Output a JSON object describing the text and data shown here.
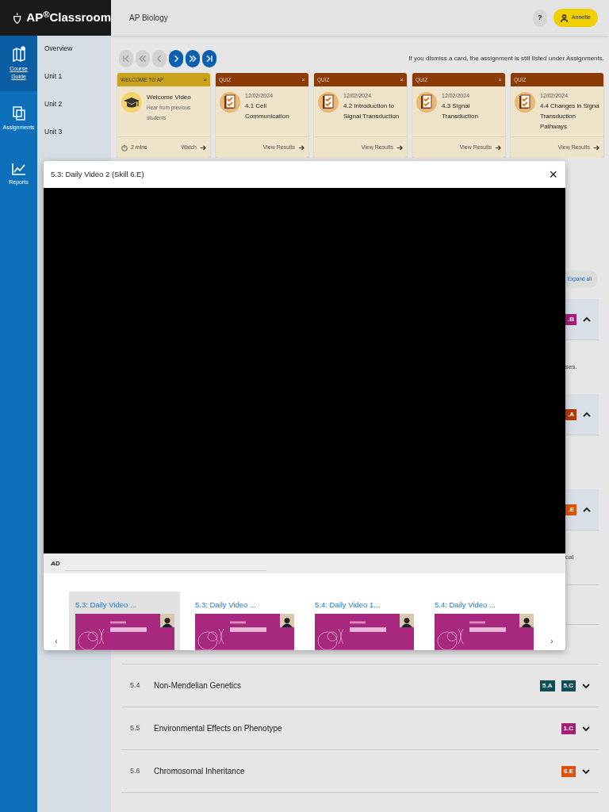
{
  "logo": {
    "text": "AP$^{®}$Classroom"
  },
  "rail": [
    {
      "label": "Course Guide",
      "selected": true
    },
    {
      "label": "Assignments",
      "selected": false
    },
    {
      "label": "Reports",
      "selected": false
    }
  ],
  "unit_nav": [
    "Overview",
    "Unit 1",
    "Unit 2",
    "Unit 3"
  ],
  "topbar": {
    "course": "AP Biology",
    "help": "?",
    "user": "Annette"
  },
  "pager": [
    {
      "disabled": true
    },
    {
      "disabled": true
    },
    {
      "disabled": true
    },
    {
      "disabled": false
    },
    {
      "disabled": false
    },
    {
      "disabled": false
    }
  ],
  "notice": "If you dismiss a card, the assignment is still listed under Assignments.",
  "cards": [
    {
      "kind": "welcome",
      "label": "WELCOME TO AP",
      "close": "×",
      "title": "Welcome Video",
      "subtitle": "Hear from previous students",
      "duration": "2 mins",
      "action": "Watch"
    },
    {
      "kind": "quiz",
      "label": "QUIZ",
      "close": "×",
      "date": "12/02/2024",
      "title": "4.1 Cell Communication",
      "action": "View Results"
    },
    {
      "kind": "quiz",
      "label": "QUIZ",
      "close": "×",
      "date": "12/02/2024",
      "title": "4.2 Introduction to Signal Transduction",
      "action": "View Results"
    },
    {
      "kind": "quiz",
      "label": "QUIZ",
      "close": "×",
      "date": "12/02/2024",
      "title": "4.3 Signal Transduction",
      "action": "View Results"
    },
    {
      "kind": "quiz",
      "label": "QUIZ",
      "date": "12/02/2024",
      "title": "4.4 Changes in Signa Transduction Pathways",
      "action": "View Results"
    }
  ],
  "expand_all": "Expand all",
  "topics": [
    {
      "kind": "covered",
      "expanded": true,
      "badges": [
        {
          "text": ".B",
          "color": "#a51d74"
        }
      ],
      "description": "ses."
    },
    {
      "kind": "covered",
      "expanded": true,
      "badges": [
        {
          "text": ".A",
          "color": "#b23a0c"
        }
      ]
    },
    {
      "kind": "covered",
      "expanded": true,
      "badges": [
        {
          "text": ".E",
          "color": "#d9540a"
        }
      ],
      "description": "cal"
    },
    {
      "kind": "hidden"
    },
    {
      "kind": "hidden"
    },
    {
      "kind": "full",
      "number": "5.4",
      "title": "Non-Mendelian Genetics",
      "expanded": false,
      "badges": [
        {
          "text": "5.A",
          "color": "#0d4e58"
        },
        {
          "text": "5.C",
          "color": "#0d4e58"
        }
      ]
    },
    {
      "kind": "full",
      "number": "5.5",
      "title": "Environmental Effects on Phenotype",
      "expanded": false,
      "badges": [
        {
          "text": "1.C",
          "color": "#a51d74"
        }
      ]
    },
    {
      "kind": "full",
      "number": "5.6",
      "title": "Chromosomal Inheritance",
      "expanded": false,
      "badges": [
        {
          "text": "6.E",
          "color": "#d9540a"
        }
      ]
    }
  ],
  "modal": {
    "title": "5.3: Daily Video 2 (Skill 6.E)",
    "close": "×",
    "player_logo": "AD",
    "prev": "‹",
    "next": "›",
    "videos": [
      {
        "title": "5.3: Daily Video ...",
        "selected": true,
        "kind": "picture"
      },
      {
        "title": "5.3: Daily Video ...",
        "selected": false,
        "kind": "picture"
      },
      {
        "title": "5.4: Daily Video 1...",
        "selected": false,
        "kind": "picture"
      },
      {
        "title": "5.4: Daily Video ...",
        "selected": false,
        "kind": "picture"
      }
    ]
  }
}
